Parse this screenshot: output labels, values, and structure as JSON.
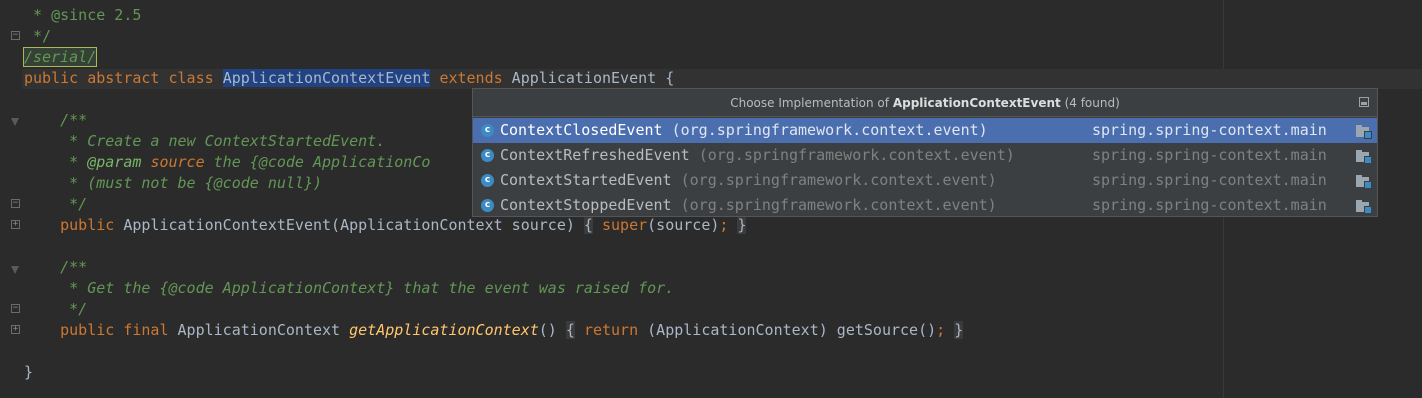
{
  "editor": {
    "lines": {
      "since": {
        "text": " * @since 2.5"
      },
      "close1": {
        "text": " */"
      },
      "serial": {
        "text": "/serial/"
      },
      "class_decl": {
        "kw1": "public",
        "kw2": "abstract",
        "kw3": "class",
        "name": "ApplicationContextEvent",
        "kw4": "extends",
        "rest": " ApplicationEvent {"
      },
      "doc1_open": {
        "text": "    /**"
      },
      "doc1_l1": {
        "text": "     * Create a new ContextStartedEvent."
      },
      "doc1_l2": {
        "pre": "     * ",
        "tag": "@param",
        "sp": " ",
        "param": "source",
        "post": " the {@code ApplicationCo"
      },
      "doc1_l3": {
        "text": "     * (must not be {@code null})"
      },
      "doc1_close": {
        "text": "     */"
      },
      "ctor": {
        "indent": "    ",
        "kw": "public",
        "sig": " ApplicationContextEvent(ApplicationContext source)",
        "sp1": " ",
        "ob": "{",
        "sp2": " ",
        "kw2": "super",
        "body": "(source)",
        "semi": ";",
        "sp3": " ",
        "cb": "}"
      },
      "doc2_open": {
        "text": "    /**"
      },
      "doc2_l1": {
        "text": "     * Get the {@code ApplicationContext} that the event was raised for."
      },
      "doc2_close": {
        "text": "     */"
      },
      "getter": {
        "indent": "    ",
        "kw1": "public",
        "kw2": "final",
        "type": " ApplicationContext ",
        "fn": "getApplicationContext",
        "parens": "()",
        "sp1": " ",
        "ob": "{",
        "sp2": " ",
        "kw3": "return",
        "body": " (ApplicationContext) getSource()",
        "semi": ";",
        "sp3": " ",
        "cb": "}"
      },
      "class_close": {
        "text": "}"
      }
    }
  },
  "popup": {
    "title_prefix": "Choose Implementation of ",
    "title_class": "ApplicationContextEvent",
    "title_suffix": " (4 found)",
    "items": [
      {
        "icon": "class-icon",
        "icon_letter": "c",
        "name": "ContextClosedEvent",
        "package": "(org.springframework.context.event)",
        "module": "spring.spring-context.main",
        "selected": true
      },
      {
        "icon": "class-icon",
        "icon_letter": "c",
        "name": "ContextRefreshedEvent",
        "package": "(org.springframework.context.event)",
        "module": "spring.spring-context.main",
        "selected": false
      },
      {
        "icon": "class-icon",
        "icon_letter": "c",
        "name": "ContextStartedEvent",
        "package": "(org.springframework.context.event)",
        "module": "spring.spring-context.main",
        "selected": false
      },
      {
        "icon": "class-icon",
        "icon_letter": "c",
        "name": "ContextStoppedEvent",
        "package": "(org.springframework.context.event)",
        "module": "spring.spring-context.main",
        "selected": false
      }
    ]
  },
  "colors": {
    "background": "#2b2b2b",
    "keyword": "#cc7832",
    "comment": "#629755",
    "selection": "#214283",
    "popup_selected": "#4b6eaf"
  }
}
